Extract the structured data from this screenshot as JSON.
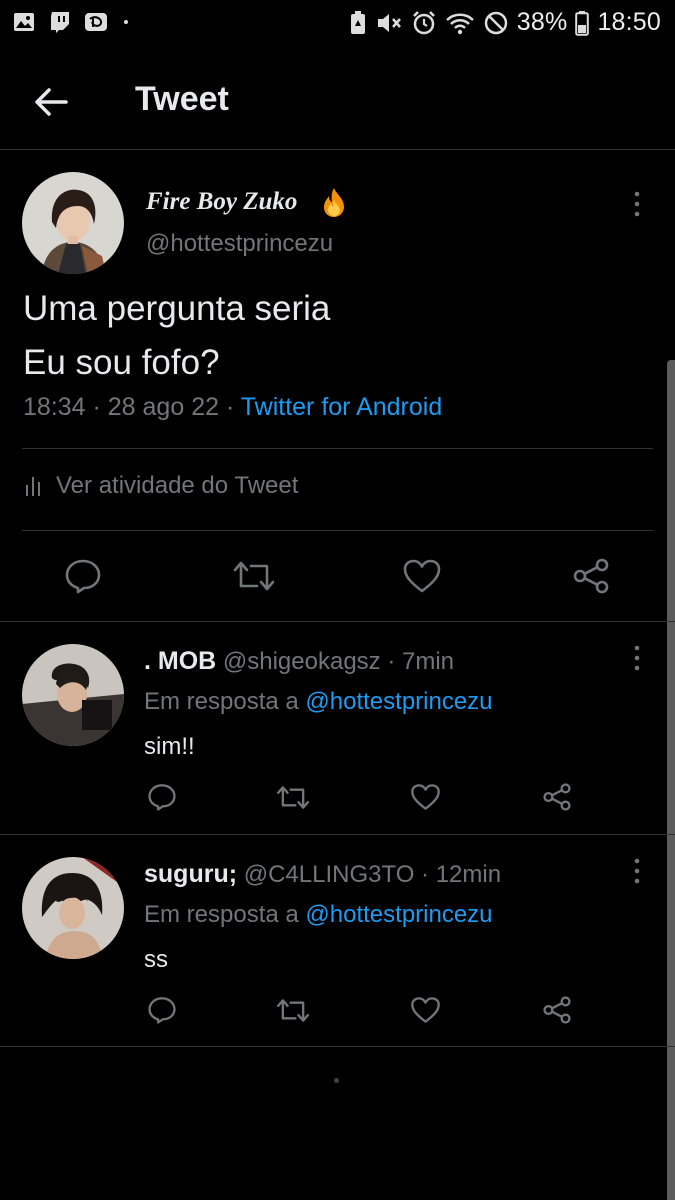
{
  "status_bar": {
    "battery": "38%",
    "time": "18:50",
    "left_icons": [
      "gallery-icon",
      "twitch-icon",
      "disney-plus-icon"
    ],
    "right_icons": [
      "battery-saver-icon",
      "mute-icon",
      "alarm-icon",
      "wifi-icon",
      "do-not-disturb-icon",
      "battery-icon"
    ]
  },
  "header": {
    "title": "Tweet"
  },
  "tweet": {
    "display_name": "Fire Boy Zuko",
    "handle": "@hottestprincezu",
    "text_line1": "Uma pergunta seria",
    "text_line2": "Eu sou fofo?",
    "time": "18:34 · 28 ago 22 · ",
    "source": "Twitter for Android",
    "activity_label": "Ver atividade do Tweet"
  },
  "replies": [
    {
      "display_name": ". MOB",
      "handle": "@shigeokagsz",
      "time": " · 7min",
      "replying_label": "Em resposta a ",
      "replying_to": "@hottestprincezu",
      "text": "sim!!"
    },
    {
      "display_name": "suguru;",
      "handle": "@C4LLING3TO",
      "time": " · 12min",
      "replying_label": "Em resposta a ",
      "replying_to": "@hottestprincezu",
      "text": "ss"
    }
  ],
  "colors": {
    "background": "#000000",
    "text": "#e7e9ea",
    "secondary": "#71767b",
    "link": "#1d9bf0",
    "divider": "#2f3336"
  }
}
